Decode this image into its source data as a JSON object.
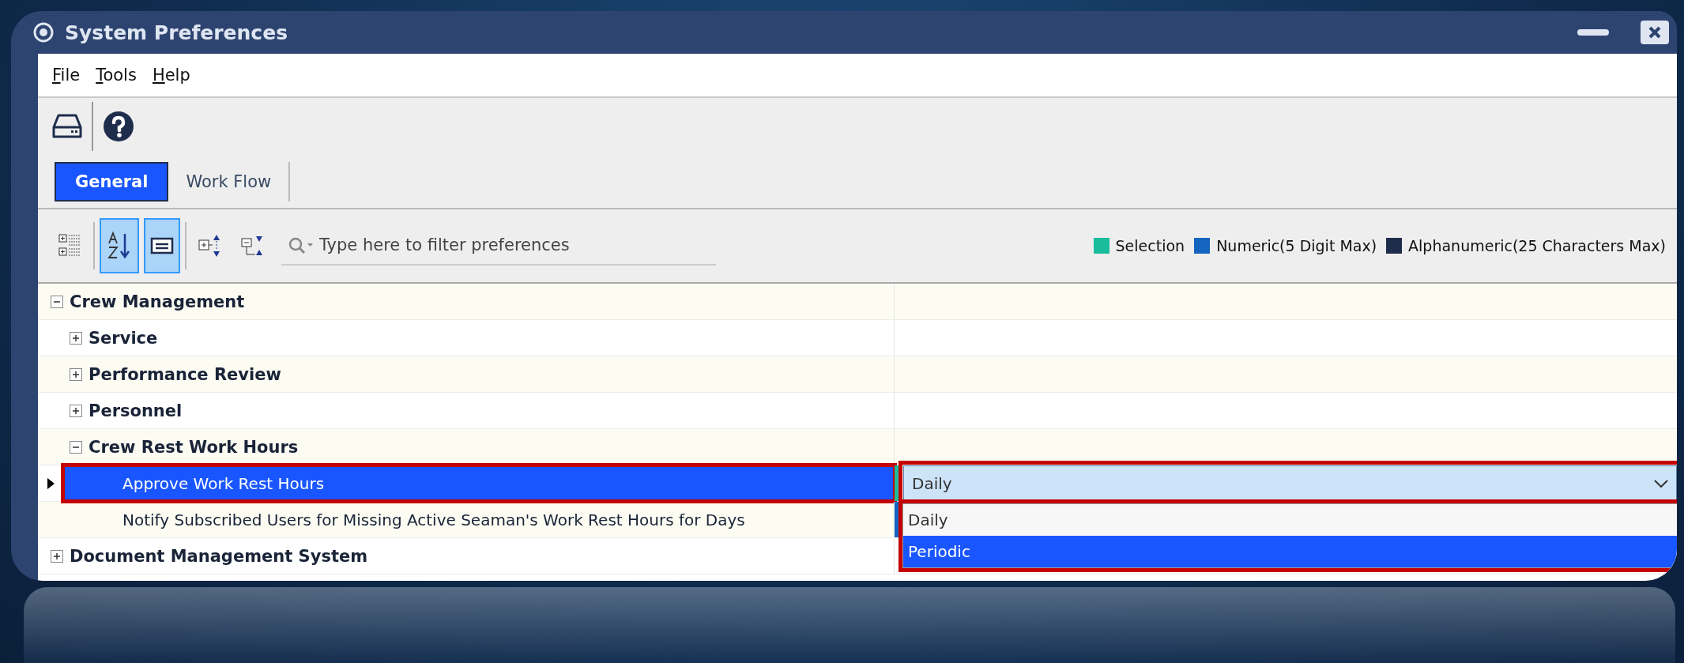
{
  "window": {
    "title": "System Preferences"
  },
  "menu": [
    {
      "label": "File"
    },
    {
      "label": "Tools"
    },
    {
      "label": "Help"
    }
  ],
  "toolbar": [
    {
      "kind": "drive"
    },
    {
      "kind": "help"
    }
  ],
  "tabs": [
    {
      "label": "General",
      "selected": true
    },
    {
      "label": "Work Flow",
      "selected": false
    }
  ],
  "view_buttons": [
    {
      "kind": "categorized",
      "on": false
    },
    {
      "kind": "alphabetical",
      "on": true
    },
    {
      "kind": "description",
      "on": true
    },
    {
      "kind": "expand",
      "on": false
    },
    {
      "kind": "collapse",
      "on": false
    }
  ],
  "filter": {
    "placeholder": "Type here to filter preferences"
  },
  "legend": [
    {
      "label": "Selection",
      "color": "#1abc9c"
    },
    {
      "label": "Numeric(5 Digit Max)",
      "color": "#1565c0"
    },
    {
      "label": "Alphanumeric(25 Characters Max)",
      "color": "#1f2d4d"
    }
  ],
  "tree": [
    {
      "kind": "group",
      "label": "Crew Management",
      "expanded": true,
      "children": [
        {
          "kind": "group",
          "label": "Service",
          "expanded": false
        },
        {
          "kind": "group",
          "label": "Performance Review",
          "expanded": false
        },
        {
          "kind": "group",
          "label": "Personnel",
          "expanded": false
        },
        {
          "kind": "group",
          "label": "Crew Rest Work Hours",
          "expanded": true,
          "children": [
            {
              "kind": "setting",
              "label": "Approve Work Rest Hours",
              "selected": true,
              "highlighted": true,
              "color": "#1abc9c",
              "value": "Daily",
              "dropdown": {
                "open": true,
                "highlighted": true,
                "options": [
                  {
                    "label": "Daily",
                    "selected": false
                  },
                  {
                    "label": "Periodic",
                    "selected": true
                  }
                ]
              }
            },
            {
              "kind": "setting",
              "label": "Notify Subscribed Users for Missing Active Seaman's Work Rest Hours for Days",
              "selected": false,
              "highlighted": false,
              "color": "#1565c0"
            }
          ]
        }
      ]
    },
    {
      "kind": "group",
      "label": "Document Management System",
      "expanded": false
    }
  ]
}
